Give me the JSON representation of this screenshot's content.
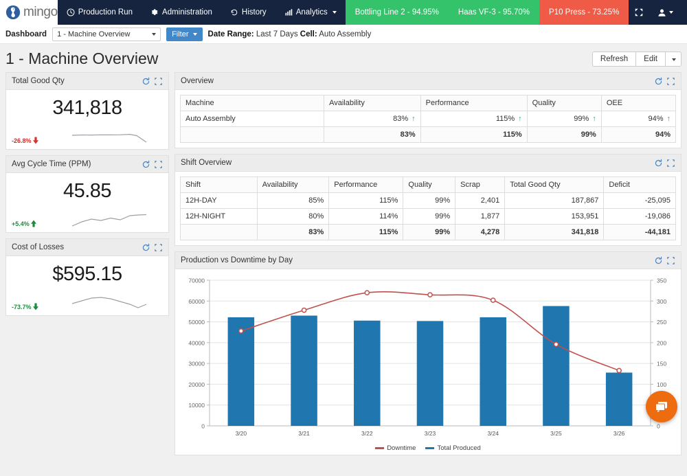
{
  "navbar": {
    "brand": "mingo",
    "brand_icon": "mingo-bird-logo",
    "links": [
      {
        "label": "Production Run",
        "icon": "clock-icon"
      },
      {
        "label": "Administration",
        "icon": "gear-icon"
      },
      {
        "label": "History",
        "icon": "history-icon"
      },
      {
        "label": "Analytics",
        "icon": "bar-chart-icon",
        "caret": true
      }
    ],
    "status_pills": [
      {
        "label": "Bottling Line 2 - 94.95%",
        "color": "#34c26b",
        "state": "green"
      },
      {
        "label": "Haas VF-3 - 95.70%",
        "color": "#34c26b",
        "state": "green"
      },
      {
        "label": "P10 Press - 73.25%",
        "color": "#ef5b47",
        "state": "red"
      }
    ],
    "right_icons": [
      {
        "name": "fullscreen-icon"
      },
      {
        "name": "user-account-icon",
        "caret": true
      }
    ]
  },
  "subbar": {
    "dashboard_label": "Dashboard",
    "dashboard_select_value": "1 - Machine Overview",
    "filter_label": "Filter",
    "date_range_label": "Date Range:",
    "date_range_value": "Last 7 Days",
    "cell_label": "Cell:",
    "cell_value": "Auto Assembly"
  },
  "page": {
    "title": "1 - Machine Overview",
    "refresh_label": "Refresh",
    "edit_label": "Edit"
  },
  "kpis": [
    {
      "title": "Total Good Qty",
      "value": "341,818",
      "delta": "-26.8%",
      "direction": "down",
      "delta_color": "#c9302c",
      "spark": [
        30,
        29,
        29,
        28,
        28,
        28,
        27,
        29,
        40
      ]
    },
    {
      "title": "Avg Cycle Time (PPM)",
      "value": "45.85",
      "delta": "+5.4%",
      "direction": "up",
      "delta_color": "#1a8c3c",
      "spark": [
        34,
        26,
        22,
        24,
        21,
        25,
        18,
        17,
        16
      ]
    },
    {
      "title": "Cost of Losses",
      "value": "$595.15",
      "delta": "-73.7%",
      "direction": "down",
      "delta_color": "#1a8c3c",
      "spark": [
        26,
        22,
        17,
        16,
        18,
        22,
        27,
        33,
        26
      ]
    }
  ],
  "overview": {
    "title": "Overview",
    "columns": [
      "Machine",
      "Availability",
      "Performance",
      "Quality",
      "OEE"
    ],
    "rows": [
      {
        "machine": "Auto Assembly",
        "availability": "83%",
        "performance": "115%",
        "quality": "99%",
        "oee": "94%",
        "trend": "up"
      }
    ],
    "totals": [
      "",
      "83%",
      "115%",
      "99%",
      "94%"
    ]
  },
  "shift_overview": {
    "title": "Shift Overview",
    "columns": [
      "Shift",
      "Availability",
      "Performance",
      "Quality",
      "Scrap",
      "Total Good Qty",
      "Deficit"
    ],
    "rows": [
      [
        "12H-DAY",
        "85%",
        "115%",
        "99%",
        "2,401",
        "187,867",
        "-25,095"
      ],
      [
        "12H-NIGHT",
        "80%",
        "114%",
        "99%",
        "1,877",
        "153,951",
        "-19,086"
      ]
    ],
    "totals": [
      "",
      "83%",
      "115%",
      "99%",
      "4,278",
      "341,818",
      "-44,181"
    ]
  },
  "chart_panel": {
    "title": "Production vs Downtime by Day"
  },
  "chart_data": {
    "type": "bar",
    "title": "Production vs Downtime by Day",
    "categories": [
      "3/20",
      "3/21",
      "3/22",
      "3/23",
      "3/24",
      "3/25",
      "3/26"
    ],
    "series": [
      {
        "name": "Total Produced",
        "type": "bar",
        "axis": "left",
        "color": "#2077b0",
        "values": [
          52200,
          53000,
          50600,
          50400,
          52200,
          57600,
          25600
        ]
      },
      {
        "name": "Downtime",
        "type": "line",
        "axis": "right",
        "color": "#c0504d",
        "values": [
          228,
          278,
          320,
          315,
          302,
          196,
          133
        ]
      }
    ],
    "xlabel": "",
    "ylabel_left": "",
    "ylabel_right": "",
    "ylim_left": [
      0,
      70000
    ],
    "ylim_right": [
      0,
      350
    ],
    "yticks_left": [
      0,
      10000,
      20000,
      30000,
      40000,
      50000,
      60000,
      70000
    ],
    "yticks_right": [
      0,
      50,
      100,
      150,
      200,
      250,
      300,
      350
    ],
    "ytick_labels_left": [
      "0",
      "10000",
      "20000",
      "30000",
      "40000",
      "50000",
      "60000",
      "70000"
    ],
    "ytick_labels_right": [
      "0",
      "50",
      "100",
      "150",
      "200",
      "250",
      "300",
      "350"
    ],
    "grid": true,
    "legend_position": "bottom",
    "legend": [
      "Downtime",
      "Total Produced"
    ]
  },
  "chat": {
    "icon": "chat-bubble-icon",
    "color": "#ee6c10"
  }
}
